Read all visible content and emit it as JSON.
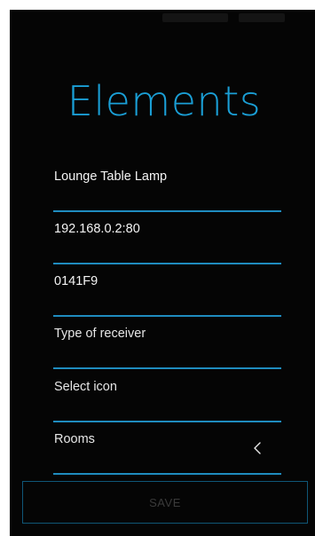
{
  "app": {
    "title": "Elements"
  },
  "form": {
    "fields": [
      {
        "name": "device-name-field",
        "value": "Lounge Table Lamp"
      },
      {
        "name": "ip-address-field",
        "value": "192.168.0.2:80"
      },
      {
        "name": "device-code-field",
        "value": "0141F9"
      },
      {
        "name": "receiver-type-select",
        "placeholder": "Type of receiver"
      },
      {
        "name": "icon-select",
        "placeholder": "Select icon"
      },
      {
        "name": "rooms-select",
        "placeholder": "Rooms"
      }
    ],
    "save_label": "SAVE"
  },
  "icons": {
    "rooms_expand": "chevron-left-icon"
  },
  "colors": {
    "accent": "#1a9fd6",
    "underline": "#1f8cbf",
    "background": "#050505",
    "button_border": "#0f5677",
    "button_text": "#3a3a3a"
  }
}
